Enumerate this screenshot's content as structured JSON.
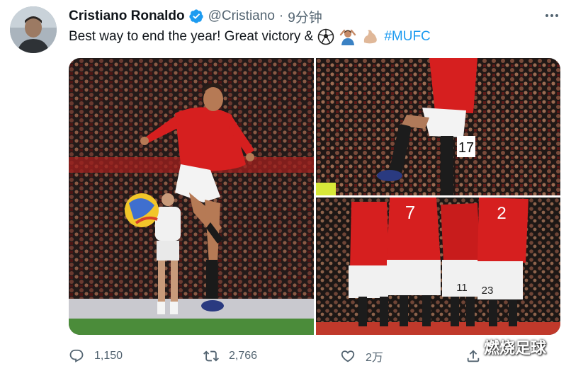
{
  "tweet": {
    "display_name": "Cristiano Ronaldo",
    "handle": "@Cristiano",
    "separator": "·",
    "time": "9分钟",
    "text": "Best way to end the year! Great victory &",
    "emojis": [
      "soccer-ball",
      "person-gesturing-ok",
      "flexed-biceps"
    ],
    "hashtag": "#MUFC",
    "verified": true
  },
  "media": {
    "photos": [
      {
        "name": "ronaldo-volley",
        "jersey_text": ""
      },
      {
        "name": "celebration-jump",
        "sign_number": "17"
      },
      {
        "name": "team-huddle",
        "jersey_numbers": [
          "7",
          "11",
          "23"
        ]
      }
    ]
  },
  "actions": {
    "reply_count": "1,150",
    "retweet_count": "2,766",
    "like_count": "2万"
  },
  "watermark": "燃烧足球",
  "colors": {
    "accent": "#1d9bf0",
    "text": "#0f1419",
    "muted": "#536471",
    "united_red": "#d81e1e"
  }
}
